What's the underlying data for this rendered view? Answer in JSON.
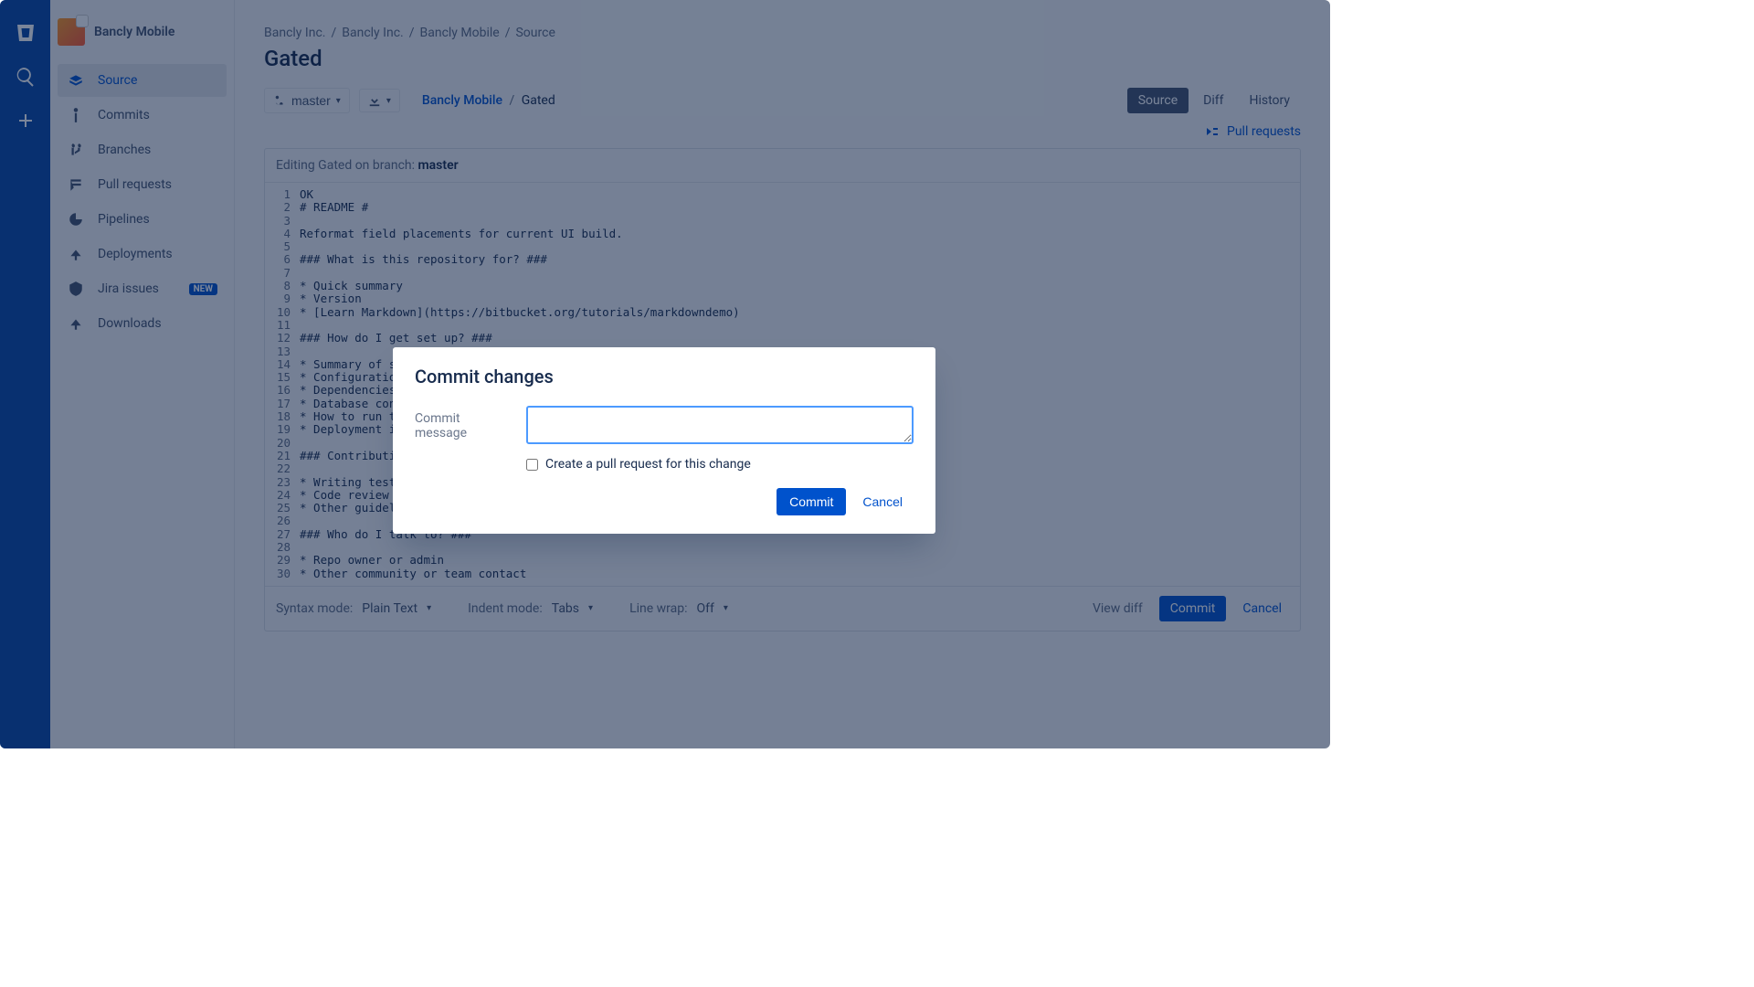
{
  "project": {
    "name": "Bancly Mobile"
  },
  "sidebar": {
    "items": [
      {
        "label": "Source",
        "active": true
      },
      {
        "label": "Commits"
      },
      {
        "label": "Branches"
      },
      {
        "label": "Pull requests"
      },
      {
        "label": "Pipelines"
      },
      {
        "label": "Deployments"
      },
      {
        "label": "Jira issues",
        "badge": "NEW"
      },
      {
        "label": "Downloads"
      }
    ]
  },
  "breadcrumb": [
    "Bancly Inc.",
    "Bancly Inc.",
    "Bancly Mobile",
    "Source"
  ],
  "page_title": "Gated",
  "branch_selector": "master",
  "path": {
    "repo": "Bancly Mobile",
    "file": "Gated"
  },
  "view_tabs": {
    "source": "Source",
    "diff": "Diff",
    "history": "History"
  },
  "pr_link": "Pull requests",
  "editor": {
    "heading_prefix": "Editing Gated on branch: ",
    "heading_branch": "master",
    "lines": [
      "OK",
      "# README #",
      "",
      "Reformat field placements for current UI build.",
      "",
      "### What is this repository for? ###",
      "",
      "* Quick summary",
      "* Version",
      "* [Learn Markdown](https://bitbucket.org/tutorials/markdowndemo)",
      "",
      "### How do I get set up? ###",
      "",
      "* Summary of set up",
      "* Configuration",
      "* Dependencies",
      "* Database configuration",
      "* How to run tests",
      "* Deployment instructions",
      "",
      "### Contribution guidelines ###",
      "",
      "* Writing tests",
      "* Code review",
      "* Other guidelines",
      "",
      "### Who do I talk to? ###",
      "",
      "* Repo owner or admin",
      "* Other community or team contact"
    ],
    "footer": {
      "syntax_label": "Syntax mode:",
      "syntax_value": "Plain Text",
      "indent_label": "Indent mode:",
      "indent_value": "Tabs",
      "wrap_label": "Line wrap:",
      "wrap_value": "Off",
      "view_diff": "View diff",
      "commit": "Commit",
      "cancel": "Cancel"
    }
  },
  "modal": {
    "title": "Commit changes",
    "message_label": "Commit message",
    "message_value": "",
    "checkbox_label": "Create a pull request for this change",
    "commit_btn": "Commit",
    "cancel_btn": "Cancel"
  },
  "colors": {
    "primary": "#0052CC",
    "navbg": "#0747A6"
  }
}
